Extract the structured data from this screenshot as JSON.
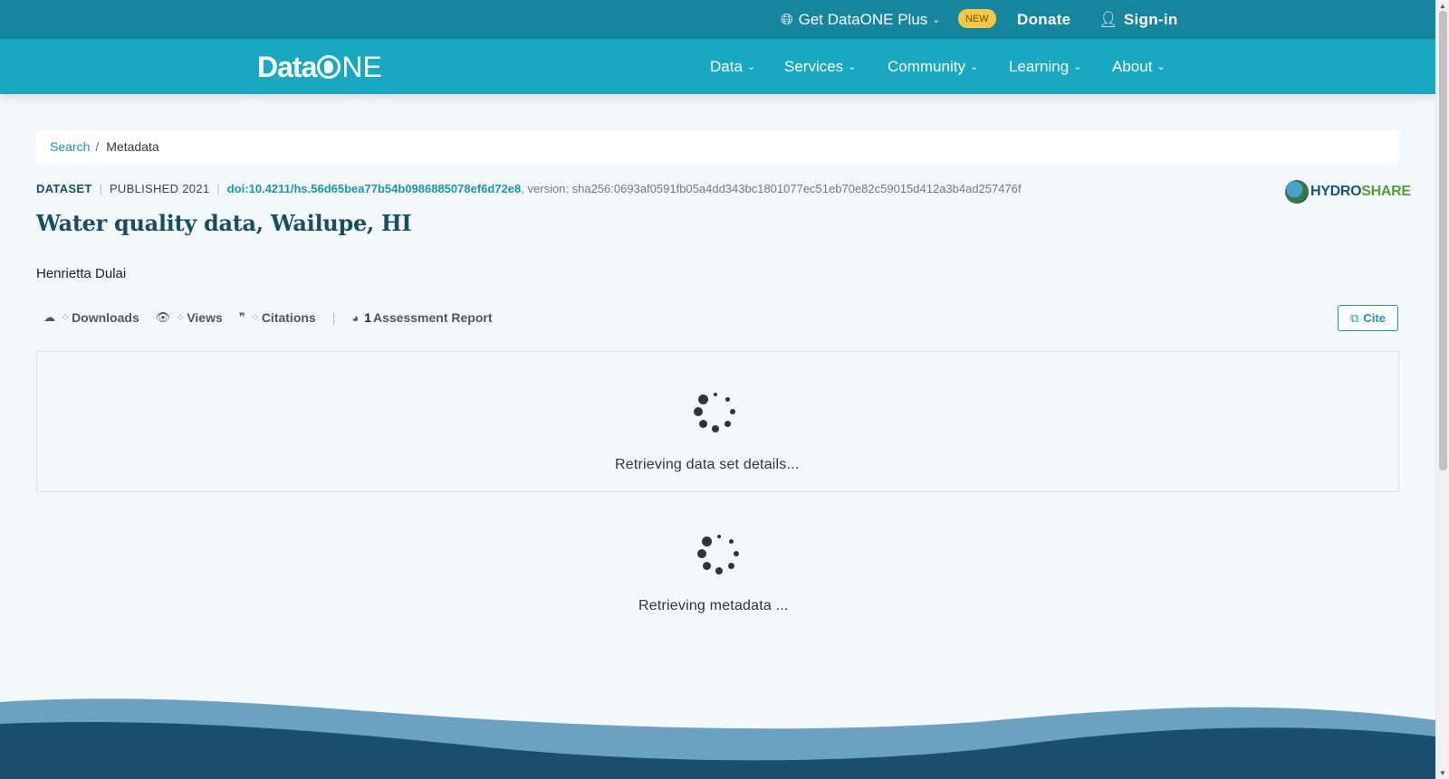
{
  "topbar": {
    "plus_label": "Get DataONE Plus",
    "new_badge": "NEW",
    "donate": "Donate",
    "signin": "Sign-in"
  },
  "logo": {
    "left": "Data",
    "right": "NE"
  },
  "nav": [
    {
      "label": "Data"
    },
    {
      "label": "Services"
    },
    {
      "label": "Community"
    },
    {
      "label": "Learning"
    },
    {
      "label": "About"
    }
  ],
  "breadcrumb": {
    "search": "Search",
    "separator": "/",
    "current": "Metadata"
  },
  "dataset": {
    "type": "DATASET",
    "published": "PUBLISHED 2021",
    "doi": "doi:10.4211/hs.56d65bea77b54b0986885078ef6d72e8",
    "version": ", version: sha256:0693af0591fb05a4dd343bc1801077ec51eb70e82c59015d412a3b4ad257476f",
    "title": "Water quality data, Wailupe, HI",
    "author": "Henrietta Dulai"
  },
  "repository": {
    "part1": "HYDRO",
    "part2": "SHARE"
  },
  "metrics": {
    "downloads": "Downloads",
    "views": "Views",
    "citations": "Citations",
    "assessment_count": "1",
    "assessment_label": "Assessment Report"
  },
  "cite_button": "Cite",
  "loading": {
    "details": "Retrieving data set details...",
    "metadata": "Retrieving metadata ..."
  },
  "colors": {
    "topbar": "#15869e",
    "navbar": "#19a8c1",
    "accent": "#1797ae",
    "title": "#1a4d60",
    "wave_light": "#6aa2bf",
    "wave_dark": "#1c4f6f"
  }
}
